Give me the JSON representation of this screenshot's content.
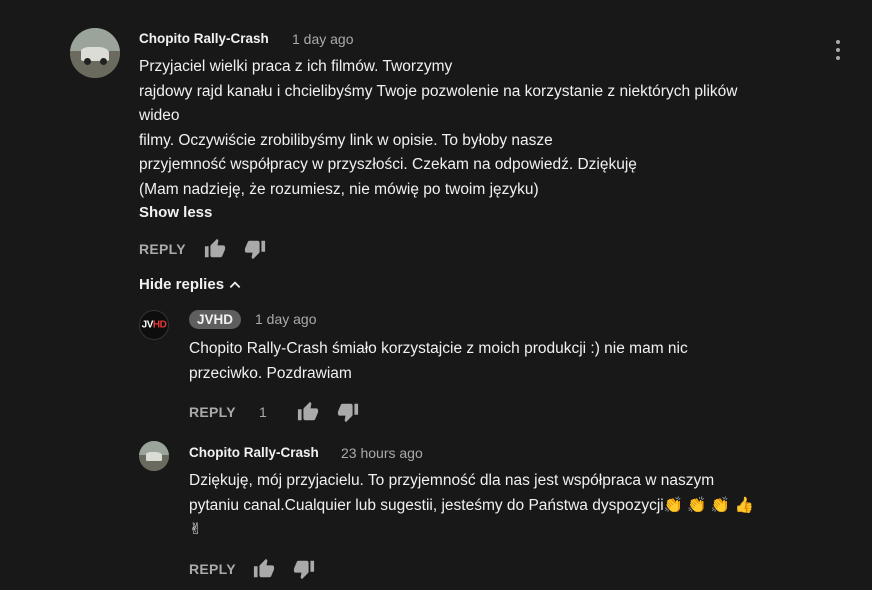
{
  "comment": {
    "author": "Chopito Rally-Crash",
    "time": "1 day ago",
    "lines": [
      "Przyjaciel wielki praca z ich filmów. Tworzymy",
      "rajdowy rajd kanału i chcielibyśmy Twoje pozwolenie na korzystanie z niektórych plików",
      "wideo",
      "filmy. Oczywiście zrobilibyśmy link w opisie. To byłoby nasze",
      "przyjemność współpracy w przyszłości. Czekam na odpowiedź. Dziękuję",
      "(Mam nadzieję, że rozumiesz, nie mówię po twoim języku)"
    ],
    "show_less": "Show less",
    "reply_label": "REPLY"
  },
  "hide_replies_label": "Hide replies",
  "replies": [
    {
      "author": "JVHD",
      "avatar_text": "JV",
      "avatar_text_accent": "HD",
      "time": "1 day ago",
      "lines": [
        "Chopito Rally-Crash  śmiało korzystajcie z moich produkcji :) nie mam nic",
        "przeciwko. Pozdrawiam"
      ],
      "reply_label": "REPLY",
      "likes": "1"
    },
    {
      "author": "Chopito Rally-Crash",
      "time": "23 hours ago",
      "lines": [
        "Dziękuję, mój przyjacielu. To przyjemność dla nas jest współpraca w naszym",
        "pytaniu canal.Cualquier lub sugestii, jesteśmy do Państwa dyspozycji"
      ],
      "emojis_line2": "👏 👏 👏 👍",
      "emojis_line3": "✌",
      "reply_label": "REPLY"
    }
  ],
  "icons": [
    "thumb-up-icon",
    "thumb-down-icon",
    "chevron-up-icon",
    "more-vert-icon"
  ]
}
